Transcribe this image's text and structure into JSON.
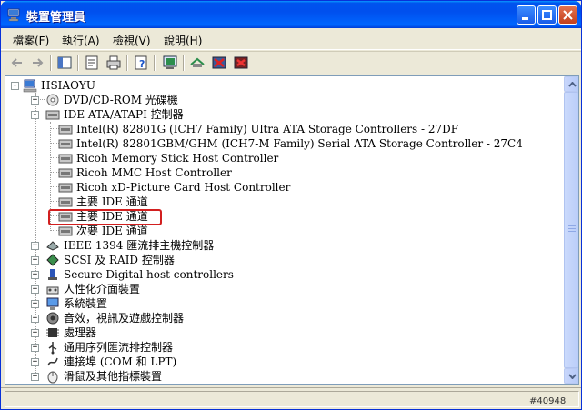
{
  "window": {
    "title": "裝置管理員"
  },
  "menu": [
    {
      "label": "檔案(F)"
    },
    {
      "label": "執行(A)"
    },
    {
      "label": "檢視(V)"
    },
    {
      "label": "說明(H)"
    }
  ],
  "tree": {
    "root": "HSIAOYU",
    "categories": [
      {
        "label": "DVD/CD-ROM 光碟機"
      },
      {
        "label": "IDE ATA/ATAPI 控制器"
      },
      {
        "label": "IEEE 1394 匯流排主機控制器"
      },
      {
        "label": "SCSI 及 RAID 控制器"
      },
      {
        "label": "Secure Digital host controllers"
      },
      {
        "label": "人性化介面裝置"
      },
      {
        "label": "系統裝置"
      },
      {
        "label": "音效，視訊及遊戲控制器"
      },
      {
        "label": "處理器"
      },
      {
        "label": "通用序列匯流排控制器"
      },
      {
        "label": "連接埠 (COM 和 LPT)"
      },
      {
        "label": "滑鼠及其他指標裝置"
      }
    ],
    "ide_children": [
      {
        "label": "Intel(R) 82801G (ICH7 Family) Ultra ATA Storage Controllers - 27DF"
      },
      {
        "label": "Intel(R) 82801GBM/GHM (ICH7-M Family) Serial ATA Storage Controller - 27C4"
      },
      {
        "label": "Ricoh Memory Stick Host Controller"
      },
      {
        "label": "Ricoh MMC Host Controller"
      },
      {
        "label": "Ricoh xD-Picture Card Host Controller"
      },
      {
        "label": "主要 IDE 通道"
      },
      {
        "label": "主要 IDE 通道"
      },
      {
        "label": "次要 IDE 通道"
      }
    ]
  },
  "watermark": "#40948",
  "colors": {
    "titlebar": "#0053EE",
    "highlight_border": "#D21F1F",
    "menu_bg": "#ECE9D8"
  }
}
